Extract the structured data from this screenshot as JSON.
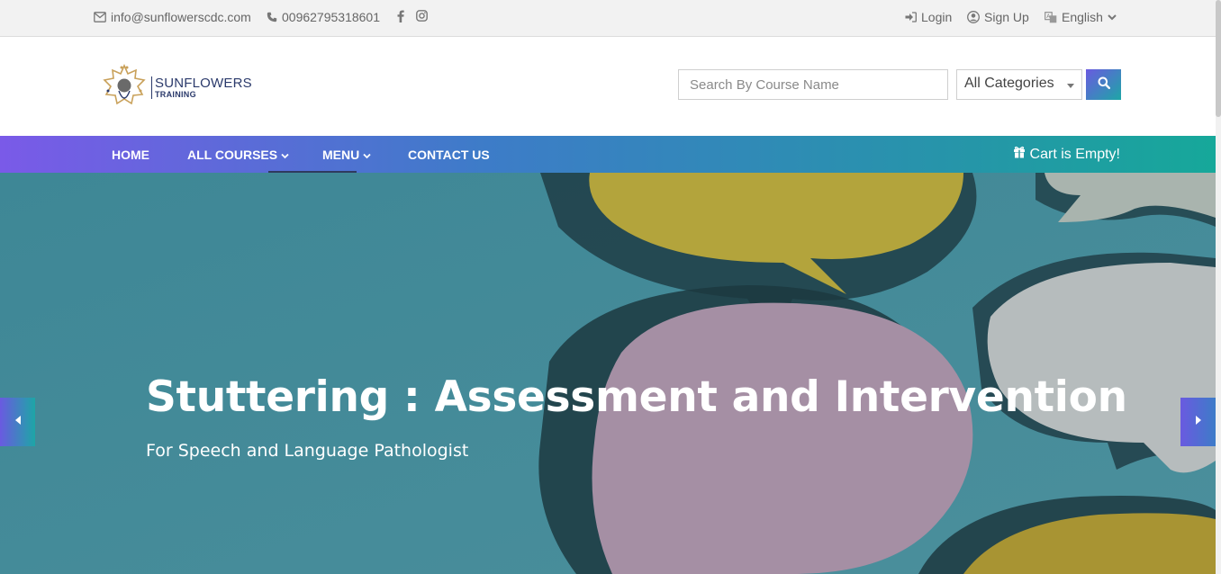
{
  "topbar": {
    "email": "info@sunflowerscdc.com",
    "phone": "00962795318601",
    "social": [
      "facebook-icon",
      "instagram-icon"
    ],
    "login": "Login",
    "signup": "Sign Up",
    "language": "English"
  },
  "header": {
    "logo_line1": "SUNFLOWERS",
    "logo_line2": "TRAINING",
    "search_placeholder": "Search By Course Name",
    "category_selected": "All Categories"
  },
  "nav": {
    "items": [
      {
        "label": "HOME",
        "dropdown": false
      },
      {
        "label": "ALL COURSES",
        "dropdown": true
      },
      {
        "label": "MENU",
        "dropdown": true
      },
      {
        "label": "CONTACT US",
        "dropdown": false
      }
    ],
    "cart": "Cart is Empty!"
  },
  "hero": {
    "title": "Stuttering : Assessment and Intervention",
    "subtitle": "For Speech and Language Pathologist"
  },
  "colors": {
    "accent_start": "#7a5ae8",
    "accent_end": "#16a89a",
    "hero_bg": "#3f8a9a"
  }
}
